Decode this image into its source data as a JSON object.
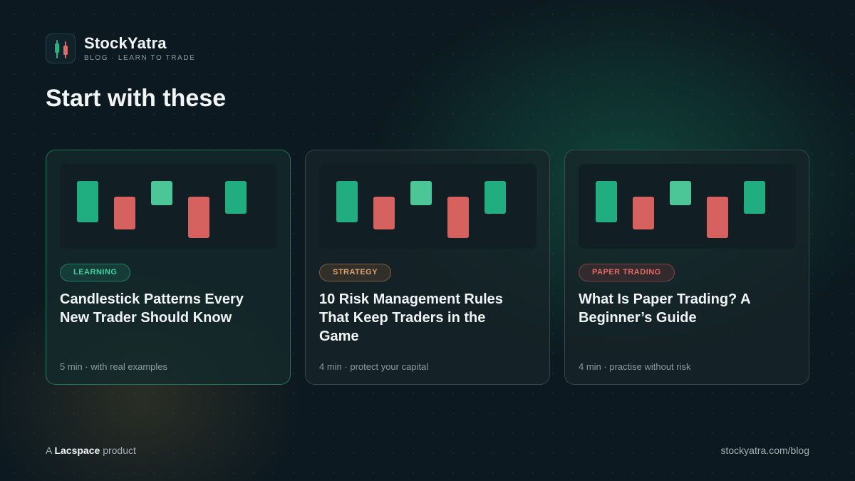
{
  "brand": {
    "name": "StockYatra",
    "tagline": "BLOG · LEARN TO TRADE",
    "logo_icon": "candlestick-icon"
  },
  "heading": "Start with these",
  "colors": {
    "green": "#20ad80",
    "light_green": "#4cc597",
    "red": "#d5625e",
    "accent_border": "#2eb482"
  },
  "cards": [
    {
      "badge": "LEARNING",
      "badge_color": "#3fd0a0",
      "title": "Candlestick Patterns Every New Trader Should Know",
      "meta": "5 min · with real examples",
      "featured": true
    },
    {
      "badge": "STRATEGY",
      "badge_color": "#e0a472",
      "title": "10 Risk Management Rules That Keep Traders in the Game",
      "meta": "4 min · protect your capital",
      "featured": false
    },
    {
      "badge": "PAPER TRADING",
      "badge_color": "#e46a66",
      "title": "What Is Paper Trading? A Beginner’s Guide",
      "meta": "4 min · practise without risk",
      "featured": false
    }
  ],
  "footer": {
    "prefix": "A",
    "company": "Lacspace",
    "suffix": "product",
    "url": "stockyatra.com/blog"
  }
}
